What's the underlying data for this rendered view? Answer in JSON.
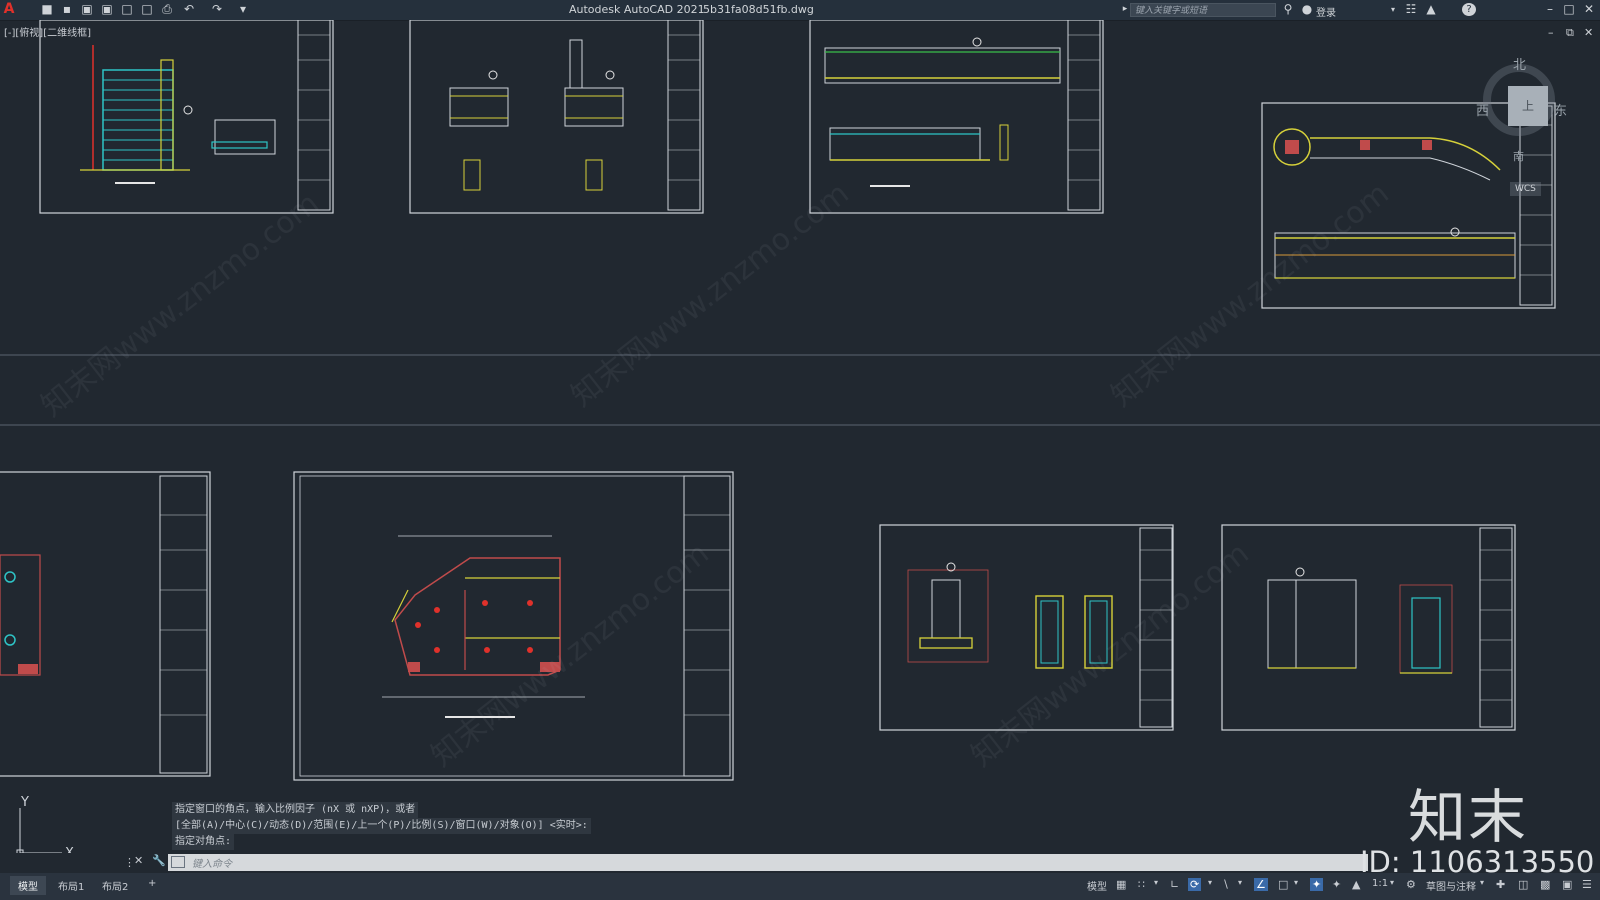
{
  "titlebar": {
    "app_title": "Autodesk AutoCAD 2021",
    "file_name": "5b31fa08d51fb.dwg",
    "search_placeholder": "键入关键字或短语",
    "login": "登录",
    "app_icon": "A",
    "colors": {
      "app_icon": "#e0312b",
      "background": "#25303c"
    }
  },
  "viewport": {
    "label": "[-][俯视][二维线框]"
  },
  "viewcube": {
    "north": "北",
    "south": "南",
    "east": "东",
    "west": "西",
    "top_face": "上",
    "wcs": "WCS"
  },
  "canvas": {
    "background": "#212830",
    "watermark_text": "知末网www.znzmo.com"
  },
  "ucs": {
    "x": "X",
    "y": "Y"
  },
  "command": {
    "history": [
      "指定窗口的角点，输入比例因子 (nX 或 nXP)，或者",
      "[全部(A)/中心(C)/动态(D)/范围(E)/上一个(P)/比例(S)/窗口(W)/对象(O)] <实时>:",
      "指定对角点:"
    ],
    "input_placeholder": "键入命令"
  },
  "layout_tabs": [
    "模型",
    "布局1",
    "布局2",
    "+"
  ],
  "status": {
    "model": "模型",
    "scale": "1:1",
    "workspace": "草图与注释"
  },
  "watermark": {
    "logo": "知末",
    "id": "ID: 1106313550"
  }
}
